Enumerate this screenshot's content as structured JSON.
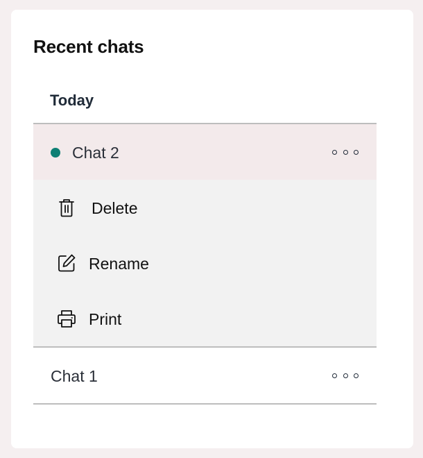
{
  "panel": {
    "title": "Recent chats"
  },
  "groups": [
    {
      "heading": "Today",
      "chats": [
        {
          "label": "Chat 2",
          "active": true,
          "status_color": "#0e7f74",
          "more_icon": "more-horizontal-icon"
        },
        {
          "label": "Chat 1",
          "active": false,
          "more_icon": "more-horizontal-icon"
        }
      ]
    }
  ],
  "context_menu": {
    "items": [
      {
        "label": "Delete",
        "icon": "trash-icon"
      },
      {
        "label": "Rename",
        "icon": "edit-icon"
      },
      {
        "label": "Print",
        "icon": "printer-icon"
      }
    ]
  },
  "colors": {
    "page_background": "#f5eff0",
    "panel_background": "#ffffff",
    "active_row_background": "#f3eaeb",
    "menu_background": "#f2f2f2",
    "divider": "#bdbdbd",
    "status_dot": "#0e7f74"
  }
}
